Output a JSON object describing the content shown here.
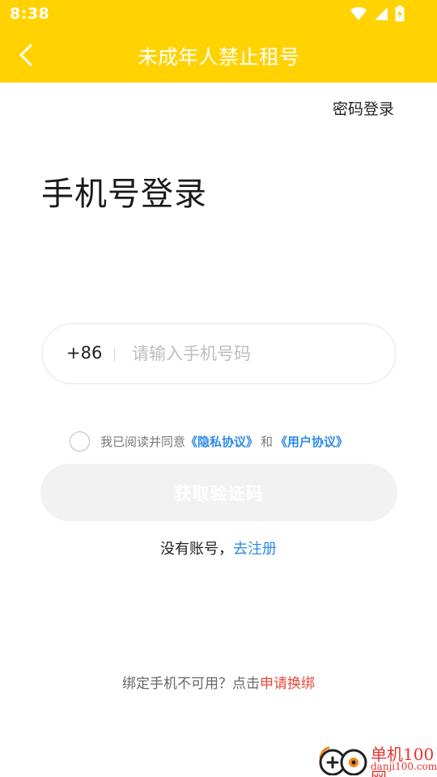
{
  "status_bar": {
    "time": "8:38"
  },
  "nav": {
    "title": "未成年人禁止租号"
  },
  "password_login_label": "密码登录",
  "page_title": "手机号登录",
  "phone_field": {
    "country_code": "+86",
    "placeholder": "请输入手机号码"
  },
  "agreement": {
    "prefix": "我已阅读并同意",
    "privacy_link": "《隐私协议》",
    "and": "和",
    "user_link": "《用户协议》"
  },
  "get_code_label": "获取验证码",
  "register": {
    "prefix": "没有账号，",
    "link": "去注册"
  },
  "rebind": {
    "prefix": "绑定手机不可用？点击",
    "link": "申请换绑"
  },
  "watermark": {
    "cn": "单机100网",
    "en": "danji100.com"
  },
  "colors": {
    "header_bg": "#FFD200",
    "link_blue": "#2E8BE8",
    "link_red": "#E84A3A",
    "button_disabled_bg": "#F2F2F2"
  }
}
